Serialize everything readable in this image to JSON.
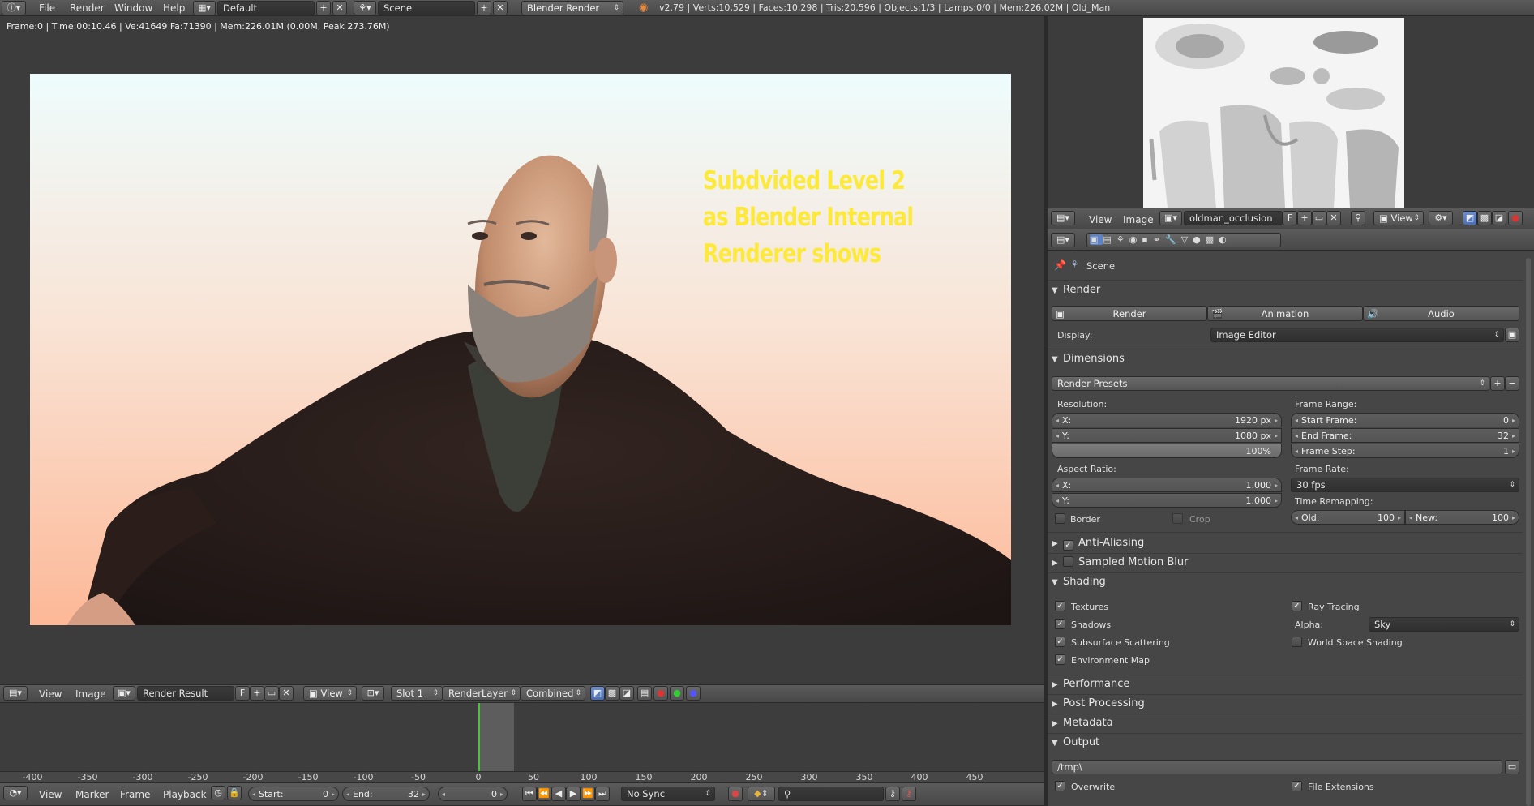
{
  "topbar": {
    "menus": [
      "File",
      "Render",
      "Window",
      "Help"
    ],
    "layout": "Default",
    "scene": "Scene",
    "engine": "Blender Render",
    "stats": "v2.79 | Verts:10,529 | Faces:10,298 | Tris:20,596 | Objects:1/3 | Lamps:0/0 | Mem:226.02M | Old_Man"
  },
  "render_view": {
    "info": "Frame:0 | Time:00:10.46 | Ve:41649 Fa:71390 | Mem:226.01M (0.00M, Peak 273.76M)",
    "overlay": [
      "Subdvided Level 2",
      "as Blender Internal",
      "Renderer shows"
    ]
  },
  "image_header": {
    "view": "View",
    "image": "Image",
    "image_name": "Render Result",
    "f": "F",
    "view_dd": "View",
    "slot": "Slot 1",
    "layer": "RenderLayer",
    "pass": "Combined"
  },
  "timeline": {
    "ticks": [
      "-400",
      "-350",
      "-300",
      "-250",
      "-200",
      "-150",
      "-100",
      "-50",
      "0",
      "50",
      "100",
      "150",
      "200",
      "250",
      "300",
      "350",
      "400",
      "450"
    ],
    "menus": [
      "View",
      "Marker",
      "Frame",
      "Playback"
    ],
    "start_label": "Start:",
    "start": "0",
    "end_label": "End:",
    "end": "32",
    "current": "0",
    "sync": "No Sync"
  },
  "uv_header": {
    "view": "View",
    "image": "Image",
    "image_name": "oldman_occlusion",
    "f": "F",
    "view_dd": "View"
  },
  "properties": {
    "context": "Scene",
    "render": {
      "title": "Render",
      "buttons": [
        "Render",
        "Animation",
        "Audio"
      ],
      "display_label": "Display:",
      "display": "Image Editor"
    },
    "dimensions": {
      "title": "Dimensions",
      "presets": "Render Presets",
      "resolution_label": "Resolution:",
      "x_label": "X:",
      "x": "1920 px",
      "y_label": "Y:",
      "y": "1080 px",
      "percent": "100%",
      "aspect_label": "Aspect Ratio:",
      "ax_label": "X:",
      "ax": "1.000",
      "ay_label": "Y:",
      "ay": "1.000",
      "border": "Border",
      "crop": "Crop",
      "frame_range_label": "Frame Range:",
      "start_label": "Start Frame:",
      "start": "0",
      "end_label": "End Frame:",
      "end": "32",
      "step_label": "Frame Step:",
      "step": "1",
      "frame_rate_label": "Frame Rate:",
      "fps": "30 fps",
      "remap_label": "Time Remapping:",
      "old_label": "Old:",
      "old": "100",
      "new_label": "New:",
      "new": "100"
    },
    "antialiasing": "Anti-Aliasing",
    "motion_blur": "Sampled Motion Blur",
    "shading": {
      "title": "Shading",
      "textures": "Textures",
      "shadows": "Shadows",
      "sss": "Subsurface Scattering",
      "env": "Environment Map",
      "raytracing": "Ray Tracing",
      "alpha_label": "Alpha:",
      "alpha": "Sky",
      "world_space": "World Space Shading"
    },
    "performance": "Performance",
    "post_processing": "Post Processing",
    "metadata": "Metadata",
    "output": {
      "title": "Output",
      "path": "/tmp\\",
      "overwrite": "Overwrite",
      "file_ext": "File Extensions"
    }
  }
}
